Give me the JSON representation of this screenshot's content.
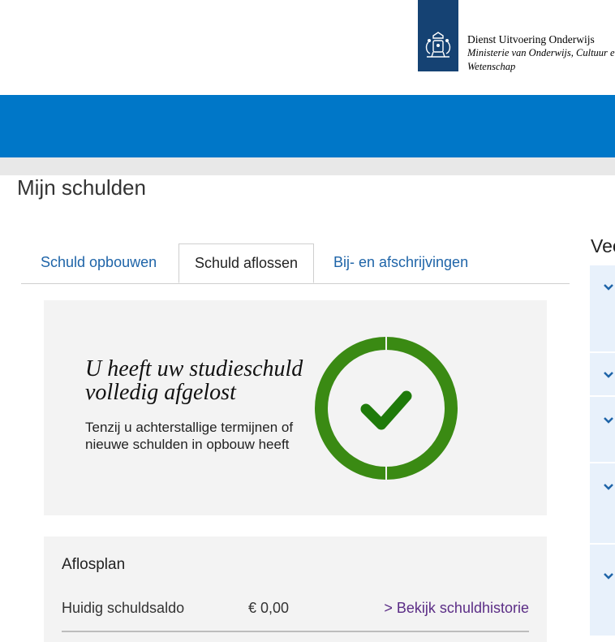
{
  "header": {
    "org_line1": "Dienst Uitvoering Onderwijs",
    "org_line2": "Ministerie van Onderwijs, Cultuur en",
    "org_line3": "Wetenschap",
    "logo_icon": "royal-coat-of-arms-icon",
    "colors": {
      "logo_bg": "#154273",
      "bar": "#0077c8"
    }
  },
  "page": {
    "title": "Mijn schulden"
  },
  "tabs": [
    {
      "label": "Schuld opbouwen",
      "active": false
    },
    {
      "label": "Schuld aflossen",
      "active": true
    },
    {
      "label": "Bij- en afschrijvingen",
      "active": false
    }
  ],
  "status": {
    "heading": "U heeft uw studieschuld volledig afgelost",
    "subtext": "Tenzij u achterstallige termijnen of nieuwe schulden in opbouw heeft",
    "icon": "check-circle-icon",
    "colors": {
      "ring": "#3a8a13",
      "check": "#1f7a0a"
    }
  },
  "plan": {
    "title": "Aflosplan",
    "rows": [
      {
        "label": "Huidig schuldsaldo",
        "value": "€ 0,00",
        "link": "> Bekijk schuldhistorie"
      }
    ]
  },
  "sidebar": {
    "title": "Vee",
    "item_icon": "chevron-down-icon"
  }
}
